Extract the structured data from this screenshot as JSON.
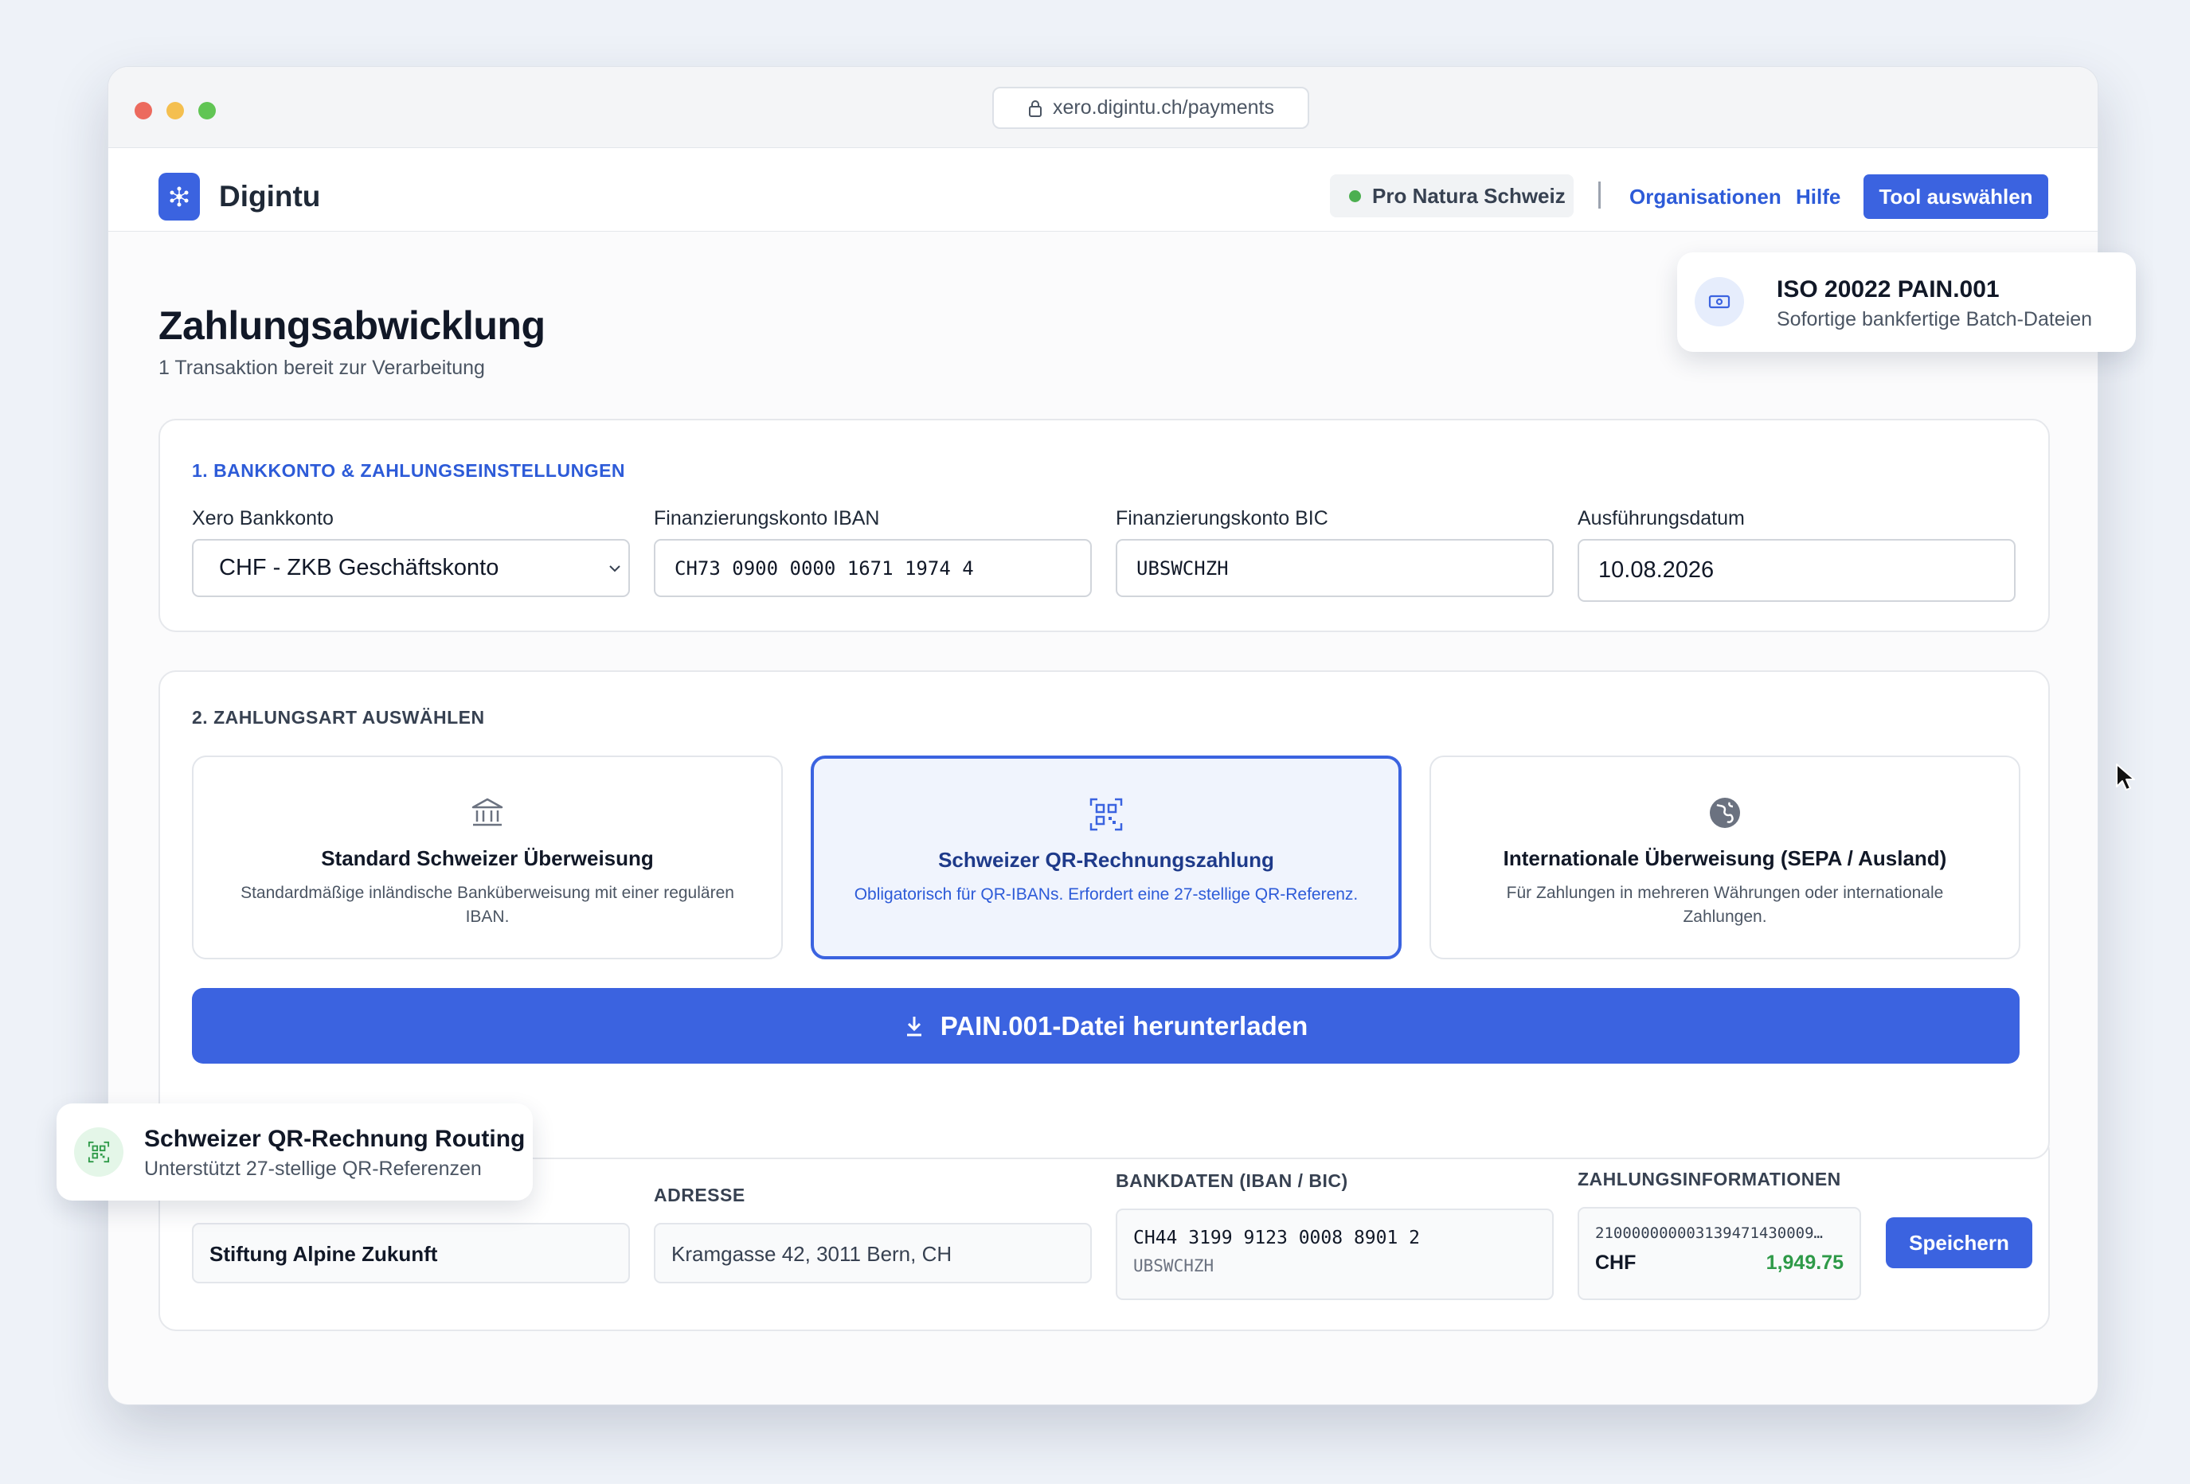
{
  "browser": {
    "url": "xero.digintu.ch/payments"
  },
  "header": {
    "brand": "Digintu",
    "organization": "Pro Natura Schweiz",
    "nav_organizations": "Organisationen",
    "nav_help": "Hilfe",
    "tool_button": "Tool auswählen"
  },
  "page": {
    "title": "Zahlungsabwicklung",
    "subtitle": "1 Transaktion bereit zur Verarbeitung"
  },
  "bank_settings": {
    "section_title": "1. BANKKONTO & ZAHLUNGSEINSTELLUNGEN",
    "xero_account_label": "Xero Bankkonto",
    "xero_account_value": "CHF - ZKB Geschäftskonto",
    "iban_label": "Finanzierungskonto IBAN",
    "iban_value": "CH73 0900 0000 1671 1974 4",
    "bic_label": "Finanzierungskonto BIC",
    "bic_value": "UBSWCHZH",
    "date_label": "Ausführungsdatum",
    "date_value": "10.08.2026"
  },
  "payment_type": {
    "section_title": "2. ZAHLUNGSART AUSWÄHLEN",
    "options": [
      {
        "title": "Standard Schweizer Überweisung",
        "description": "Standardmäßige inländische Banküberweisung mit einer regulären IBAN.",
        "icon": "bank-icon",
        "selected": false
      },
      {
        "title": "Schweizer QR-Rechnungszahlung",
        "description": "Obligatorisch für QR-IBANs. Erfordert eine 27-stellige QR-Referenz.",
        "icon": "qr-code-icon",
        "selected": true
      },
      {
        "title": "Internationale Überweisung (SEPA / Ausland)",
        "description": "Für Zahlungen in mehreren Währungen oder internationale Zahlungen.",
        "icon": "globe-icon",
        "selected": false
      }
    ],
    "download_button": "PAIN.001-Datei herunterladen"
  },
  "transaction": {
    "col_address": "ADRESSE",
    "col_bank": "BANKDATEN (IBAN / BIC)",
    "col_payment": "ZAHLUNGSINFORMATIONEN",
    "recipient_name": "Stiftung Alpine Zukunft",
    "address": "Kramgasse 42, 3011 Bern, CH",
    "iban": "CH44 3199 9123 0008 8901 2",
    "bic": "UBSWCHZH",
    "reference": "210000000003139471430009…",
    "currency": "CHF",
    "amount": "1,949.75",
    "save_button": "Speichern"
  },
  "floats": {
    "iso_title": "ISO 20022 PAIN.001",
    "iso_sub": "Sofortige bankfertige Batch-Dateien",
    "qr_title": "Schweizer QR-Rechnung Routing",
    "qr_sub": "Unterstützt 27-stellige QR-Referenzen"
  },
  "colors": {
    "accent": "#3b63e0",
    "success": "#2e9a48",
    "status_dot": "#4caf50"
  }
}
